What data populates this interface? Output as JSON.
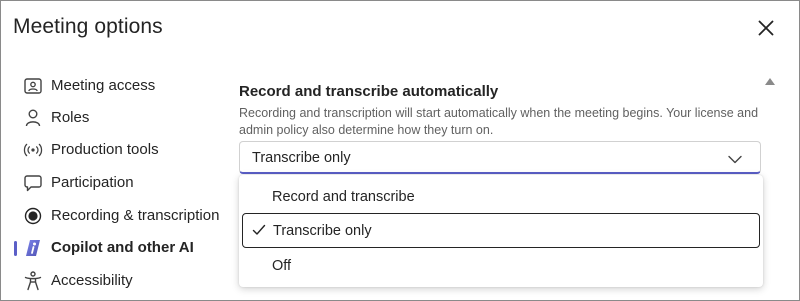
{
  "dialog": {
    "title": "Meeting options",
    "close_icon": "close-icon"
  },
  "sidebar": {
    "items": [
      {
        "label": "Meeting access",
        "icon": "person-card-icon",
        "active": false
      },
      {
        "label": "Roles",
        "icon": "person-icon",
        "active": false
      },
      {
        "label": "Production tools",
        "icon": "broadcast-icon",
        "active": false
      },
      {
        "label": "Participation",
        "icon": "chat-icon",
        "active": false
      },
      {
        "label": "Recording & transcription",
        "icon": "record-icon",
        "active": false
      },
      {
        "label": "Copilot and other AI",
        "icon": "copilot-icon",
        "active": true
      },
      {
        "label": "Accessibility",
        "icon": "accessibility-icon",
        "active": false
      }
    ],
    "accent_color": "#5b5fc7"
  },
  "content": {
    "section_title": "Record and transcribe automatically",
    "section_desc": "Recording and transcription will start automatically when the meeting begins. Your license and admin policy also determine how they turn on.",
    "select": {
      "value": "Transcribe only",
      "icon": "chevron-down-icon"
    },
    "dropdown": {
      "options": [
        {
          "label": "Record and transcribe",
          "selected": false
        },
        {
          "label": "Transcribe only",
          "selected": true
        },
        {
          "label": "Off",
          "selected": false
        }
      ]
    }
  }
}
